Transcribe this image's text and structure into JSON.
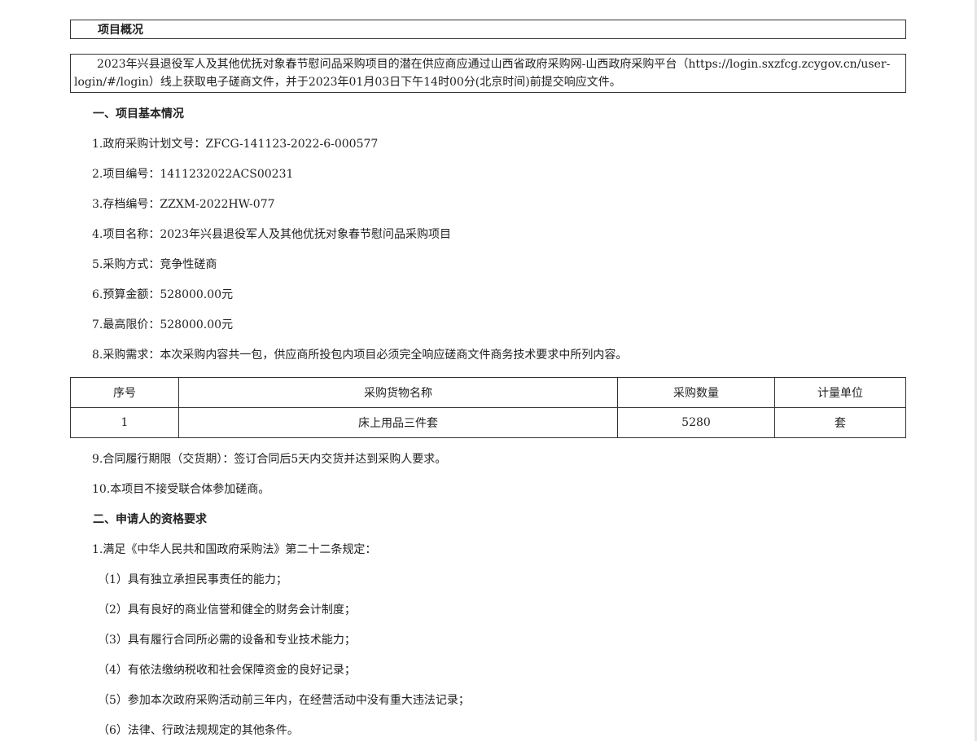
{
  "overview": {
    "title": "项目概况",
    "intro": "2023年兴县退役军人及其他优抚对象春节慰问品采购项目的潜在供应商应通过山西省政府采购网-山西政府采购平台（https://login.sxzfcg.zcygov.cn/user-login/#/login）线上获取电子磋商文件，并于2023年01月03日下午14时00分(北京时间)前提交响应文件。"
  },
  "section1": {
    "heading": "一、项目基本情况",
    "items": [
      {
        "label": "1.政府采购计划文号：",
        "value": "ZFCG-141123-2022-6-000577"
      },
      {
        "label": "2.项目编号：",
        "value": "1411232022ACS00231"
      },
      {
        "label": "3.存档编号：",
        "value": "ZZXM-2022HW-077"
      },
      {
        "label": "4.项目名称：",
        "value": "2023年兴县退役军人及其他优抚对象春节慰问品采购项目"
      },
      {
        "label": "5.采购方式：",
        "value": "竞争性磋商"
      },
      {
        "label": "6.预算金额：",
        "value": "528000.00元"
      },
      {
        "label": "7.最高限价：",
        "value": "528000.00元"
      },
      {
        "label": "8.采购需求：",
        "value": "本次采购内容共一包，供应商所投包内项目必须完全响应磋商文件商务技术要求中所列内容。"
      }
    ],
    "table": {
      "headers": [
        "序号",
        "采购货物名称",
        "采购数量",
        "计量单位"
      ],
      "rows": [
        [
          "1",
          "床上用品三件套",
          "5280",
          "套"
        ]
      ]
    },
    "item9": {
      "label": "9.合同履行期限（交货期）：",
      "value": "签订合同后5天内交货并达到采购人要求。"
    },
    "item10": "10.本项目不接受联合体参加磋商。"
  },
  "section2": {
    "heading": "二、申请人的资格要求",
    "intro": "1.满足《中华人民共和国政府采购法》第二十二条规定：",
    "conditions": [
      "（1）具有独立承担民事责任的能力；",
      "（2）具有良好的商业信誉和健全的财务会计制度；",
      "（3）具有履行合同所必需的设备和专业技术能力；",
      "（4）有依法缴纳税收和社会保障资金的良好记录；",
      "（5）参加本次政府采购活动前三年内，在经营活动中没有重大违法记录；",
      "（6）法律、行政法规规定的其他条件。"
    ]
  }
}
